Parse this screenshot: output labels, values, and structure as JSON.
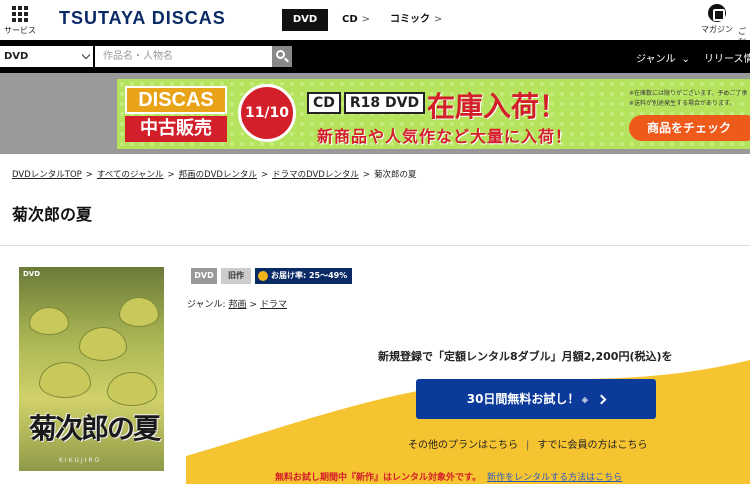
{
  "header": {
    "services_label": "サービス",
    "logo": "TSUTAYA DISCAS",
    "tabs": [
      {
        "label": "DVD",
        "active": true
      },
      {
        "label": "CD",
        "active": false
      },
      {
        "label": "コミック",
        "active": false
      }
    ],
    "magazine_label": "マガジン",
    "more_label": "ご利"
  },
  "search": {
    "category": "DVD",
    "placeholder": "作品名・人物名",
    "genre_label": "ジャンル",
    "release_label": "リリース情"
  },
  "banner": {
    "logo_line1": "DISCAS",
    "logo_line2": "中古販売",
    "date": "11/10",
    "formats": [
      "CD",
      "R18 DVD"
    ],
    "headline": "在庫入荷！",
    "subline": "新商品や人気作など大量に入荷！",
    "notes": [
      "※在庫数には限りがございます。予めご了承",
      "※送料が別途発生する場合があります。"
    ],
    "button_label": "商品をチェック"
  },
  "breadcrumb": [
    "DVDレンタルTOP",
    "すべてのジャンル",
    "邦画のDVDレンタル",
    "ドラマのDVDレンタル",
    "菊次郎の夏"
  ],
  "title": "菊次郎の夏",
  "poster": {
    "label": "DVD",
    "title_text": "菊次郎の夏",
    "romaji": "KIKUJIRO"
  },
  "tags": {
    "format": "DVD",
    "age": "旧作",
    "delivery_rate": "お届け率: 25〜49%"
  },
  "genre": {
    "label": "ジャンル:",
    "items": [
      "邦画",
      "ドラマ"
    ]
  },
  "promo": {
    "headline": "新規登録で「定額レンタル8ダブル」月額2,200円(税込)を",
    "cta_label": "30日間無料お試し！",
    "cta_asterisk": "※",
    "other_plans": "その他のプランはこちら",
    "members": "すでに会員の方はこちら",
    "notice": "無料お試し期間中『新作』はレンタル対象外です。",
    "notice_link": "新作をレンタルする方法はこちら"
  },
  "colors": {
    "brand_navy": "#0a2a66",
    "cta_blue": "#0b3a9a",
    "accent_red": "#d31f2a",
    "promo_yellow": "#f7c431"
  }
}
